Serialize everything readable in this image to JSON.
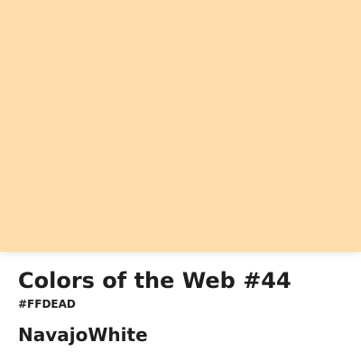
{
  "swatch": {
    "color": "#FFDEAD"
  },
  "title": "Colors of the Web #44",
  "hex_code": "#FFDEAD",
  "color_name": "NavajoWhite"
}
